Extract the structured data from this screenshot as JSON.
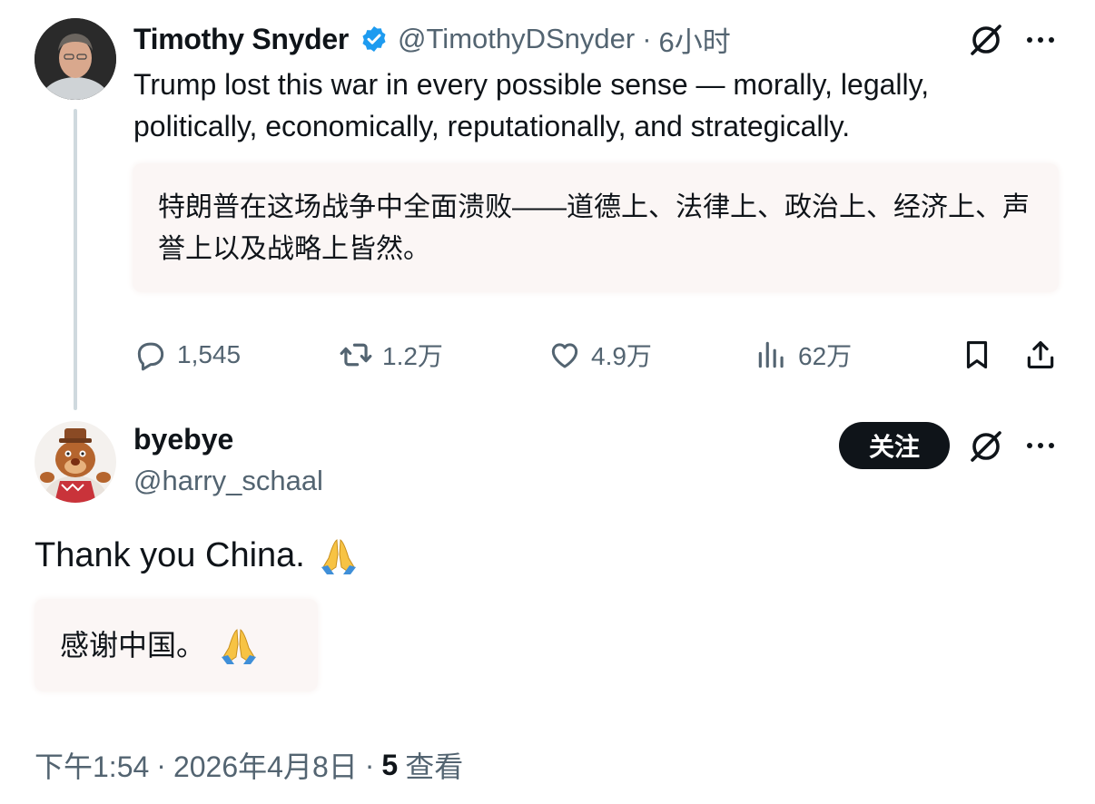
{
  "tweet": {
    "author_name": "Timothy Snyder",
    "handle": "@TimothyDSnyder",
    "separator": "·",
    "time": "6小时",
    "text": "Trump lost this war in every possible sense — morally, legally, politically, economically, reputationally, and strategically.",
    "translation": "特朗普在这场战争中全面溃败——道德上、法律上、政治上、经济上、声誉上以及战略上皆然。",
    "stats": {
      "replies": "1,545",
      "reposts": "1.2万",
      "likes": "4.9万",
      "views": "62万"
    }
  },
  "reply": {
    "author_name": "byebye",
    "handle": "@harry_schaal",
    "follow_label": "关注",
    "text": "Thank you China.",
    "translation": "感谢中国。",
    "emoji_icon": "folded-hands-icon",
    "timestamp": "下午1:54",
    "separator": "·",
    "date": "2026年4月8日",
    "views_count": "5",
    "views_label": "查看"
  },
  "colors": {
    "text_primary": "#0f1419",
    "text_secondary": "#536471",
    "verified_blue": "#1d9bf0",
    "translation_bg": "#fbf6f5",
    "follow_bg": "#0f1419",
    "thread_line": "#cfd9de"
  },
  "icons": {
    "verified": "verified-badge-icon",
    "grok": "grok-icon",
    "more": "more-icon",
    "reply": "reply-icon",
    "repost": "repost-icon",
    "like": "heart-icon",
    "views": "views-icon",
    "bookmark": "bookmark-icon",
    "share": "share-icon"
  }
}
